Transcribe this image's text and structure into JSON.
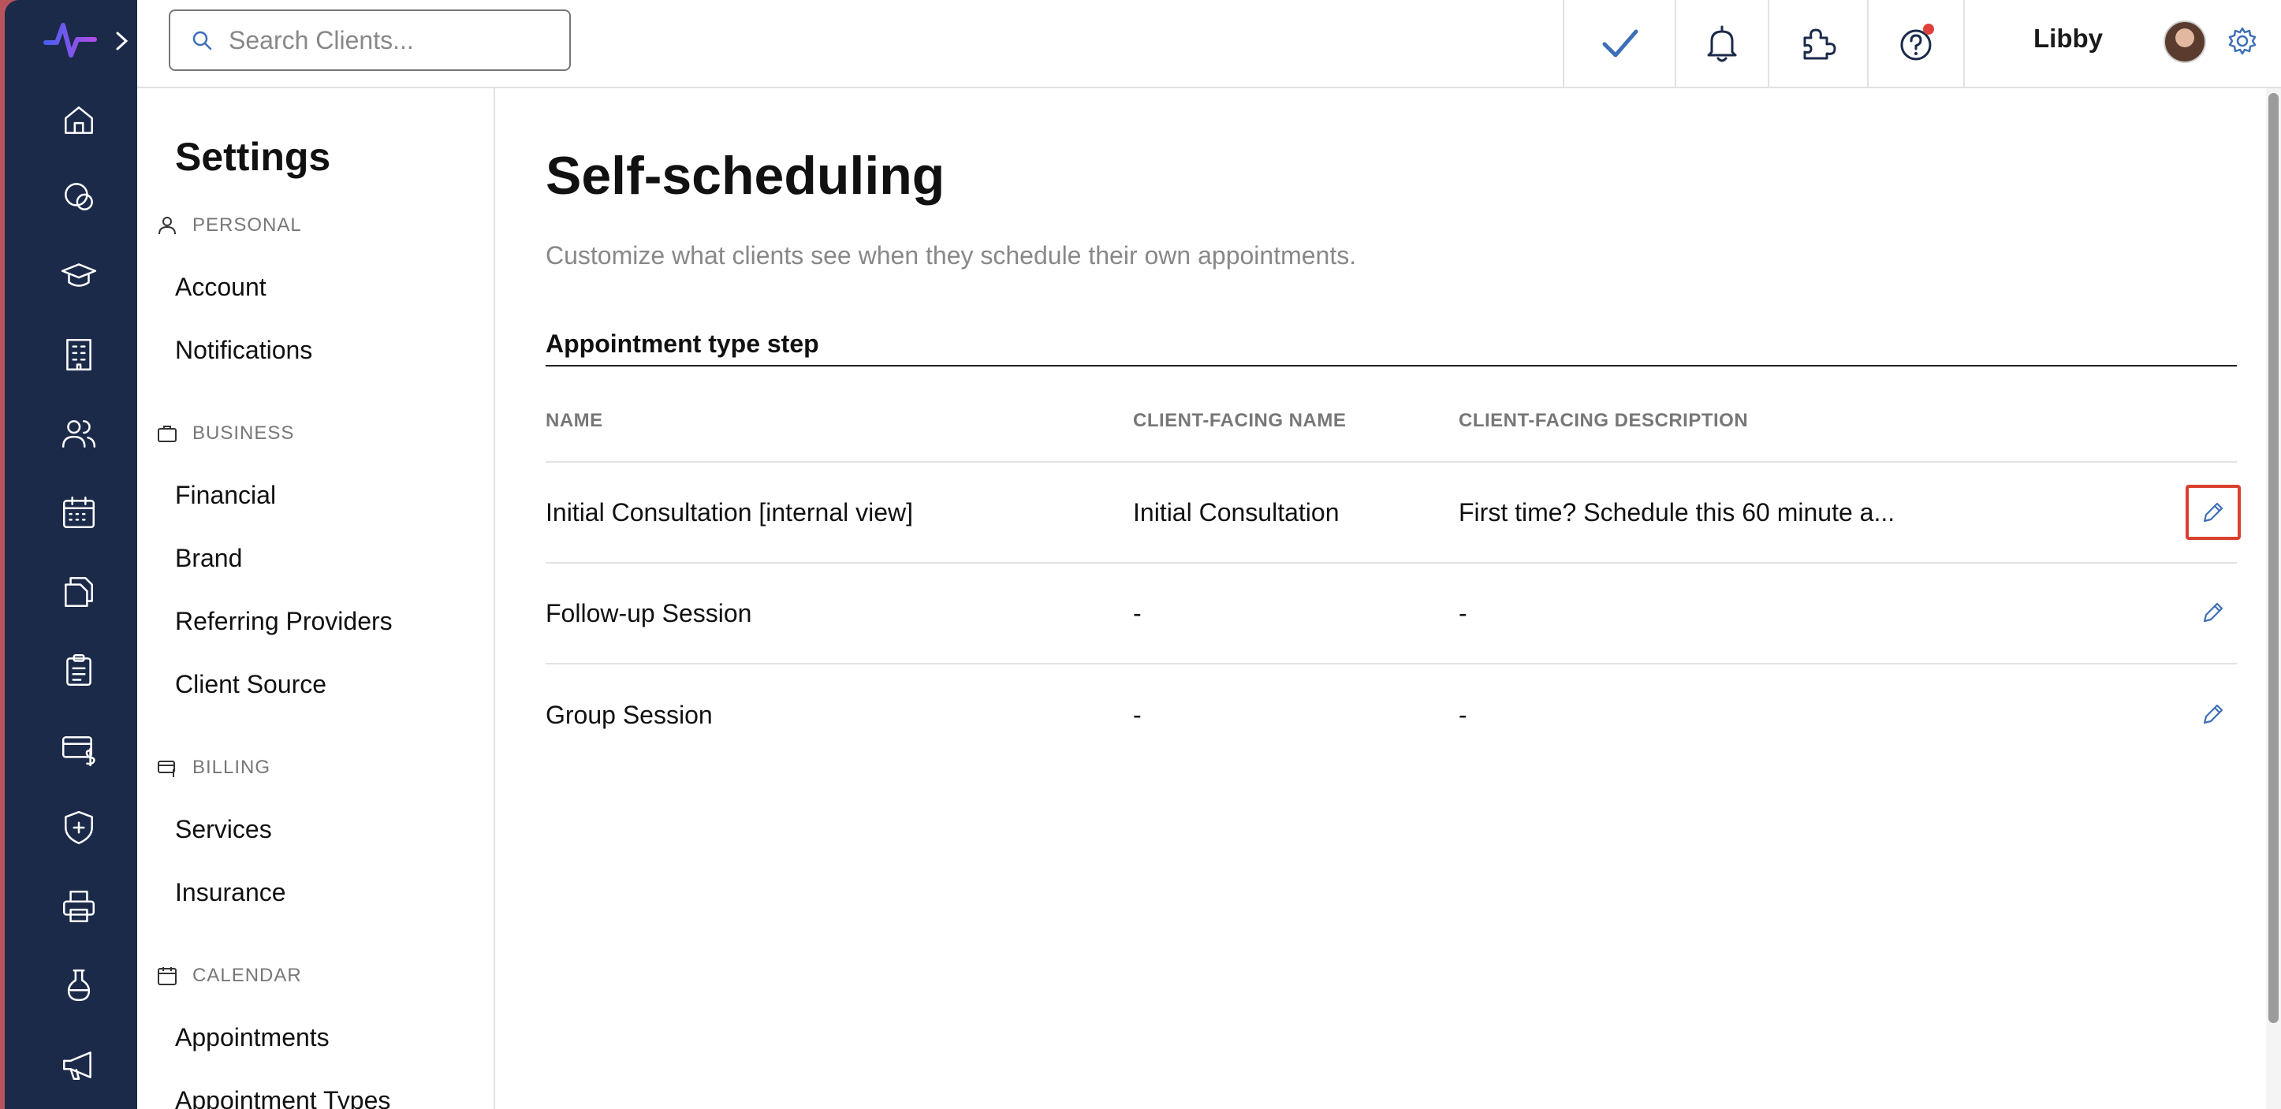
{
  "topbar": {
    "search_placeholder": "Search Clients...",
    "user_name": "Libby",
    "notification_dot_color": "#e0403a",
    "accent_color": "#3d6fb8"
  },
  "rail": {
    "icons": [
      "home-icon",
      "chat-icon",
      "graduation-cap-icon",
      "building-icon",
      "people-icon",
      "calendar-icon",
      "documents-icon",
      "clipboard-icon",
      "billing-icon",
      "shield-icon",
      "printer-icon",
      "flask-icon",
      "megaphone-icon"
    ]
  },
  "settings": {
    "title": "Settings",
    "sections": {
      "personal": "PERSONAL",
      "business": "BUSINESS",
      "billing": "BILLING",
      "calendar": "CALENDAR"
    },
    "items": {
      "account": "Account",
      "notifications": "Notifications",
      "financial": "Financial",
      "brand": "Brand",
      "referring_providers": "Referring Providers",
      "client_source": "Client Source",
      "services": "Services",
      "insurance": "Insurance",
      "appointments": "Appointments",
      "appointment_types": "Appointment Types"
    }
  },
  "main": {
    "title": "Self-scheduling",
    "subtitle": "Customize what clients see when they schedule their own appointments.",
    "section_title": "Appointment type step",
    "columns": {
      "name": "NAME",
      "client_facing_name": "CLIENT-FACING NAME",
      "client_facing_description": "CLIENT-FACING DESCRIPTION"
    },
    "rows": [
      {
        "name": "Initial Consultation [internal view]",
        "client_name": "Initial Consultation",
        "client_description": "First time? Schedule this 60 minute a..."
      },
      {
        "name": "Follow-up Session",
        "client_name": "-",
        "client_description": "-"
      },
      {
        "name": "Group Session",
        "client_name": "-",
        "client_description": "-"
      }
    ]
  }
}
